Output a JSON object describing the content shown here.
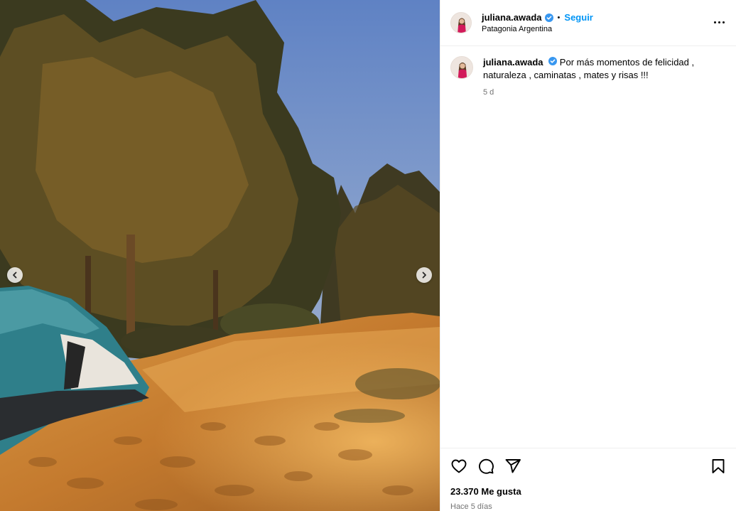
{
  "post": {
    "username": "juliana.awada",
    "follow_label": "Seguir",
    "separator": "•",
    "location": "Patagonia Argentina",
    "caption": "Por más momentos de felicidad , naturaleza , caminatas , mates y risas !!!",
    "caption_time": "5 d",
    "likes": "23.370 Me gusta",
    "posted_ago": "Hace 5 días"
  },
  "icons": {
    "verified": "verified-badge-icon",
    "more": "more-options-icon",
    "like": "heart-icon",
    "comment": "comment-icon",
    "share": "send-icon",
    "save": "bookmark-icon",
    "prev": "chevron-left-icon",
    "next": "chevron-right-icon"
  },
  "colors": {
    "accent": "#0095f6",
    "verified": "#3897f0",
    "muted": "#737373",
    "divider": "#efefef"
  }
}
